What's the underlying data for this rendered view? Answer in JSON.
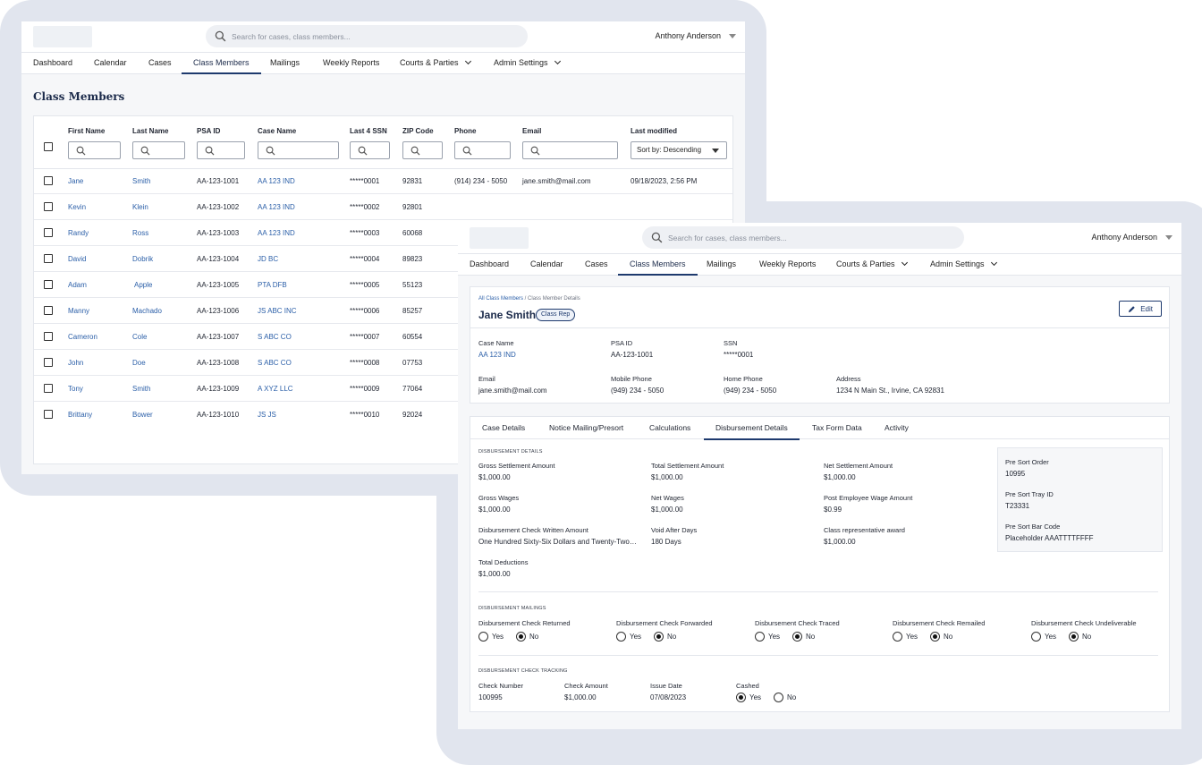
{
  "app": {
    "search_placeholder": "Search for cases, class members...",
    "user_name": "Anthony Anderson",
    "nav": [
      {
        "label": "Dashboard"
      },
      {
        "label": "Calendar"
      },
      {
        "label": "Cases"
      },
      {
        "label": "Class Members"
      },
      {
        "label": "Mailings"
      },
      {
        "label": "Weekly Reports"
      },
      {
        "label": "Courts & Parties"
      },
      {
        "label": "Admin Settings"
      }
    ],
    "active_nav": "Class Members"
  },
  "list_page": {
    "title": "Class Members",
    "columns": {
      "first_name": "First Name",
      "last_name": "Last Name",
      "psa_id": "PSA ID",
      "case_name": "Case Name",
      "last4": "Last 4 SSN",
      "zip": "ZIP Code",
      "phone": "Phone",
      "email": "Email",
      "last_modified": "Last modified"
    },
    "sort_label": "Sort by: Descending",
    "rows": [
      {
        "first": "Jane",
        "last": "Smith",
        "psa": "AA-123-1001",
        "case": "AA 123 IND",
        "ssn": "*****0001",
        "zip": "92831",
        "phone": "(914) 234 - 5050",
        "email": "jane.smith@mail.com",
        "modified": "09/18/2023, 2:56 PM"
      },
      {
        "first": "Kevin",
        "last": "Klein",
        "psa": "AA-123-1002",
        "case": "AA 123 IND",
        "ssn": "*****0002",
        "zip": "92801"
      },
      {
        "first": "Randy",
        "last": "Ross",
        "psa": "AA-123-1003",
        "case": "AA 123 IND",
        "ssn": "*****0003",
        "zip": "60068"
      },
      {
        "first": "David",
        "last": "Dobrik",
        "psa": "AA-123-1004",
        "case": "JD BC",
        "ssn": "*****0004",
        "zip": "89823"
      },
      {
        "first": "Adam",
        "last": "Apple",
        "psa": "AA-123-1005",
        "case": "PTA DFB",
        "ssn": "*****0005",
        "zip": "55123"
      },
      {
        "first": "Manny",
        "last": "Machado",
        "psa": "AA-123-1006",
        "case": "JS ABC INC",
        "ssn": "*****0006",
        "zip": "85257"
      },
      {
        "first": "Cameron",
        "last": "Cole",
        "psa": "AA-123-1007",
        "case": "S ABC CO",
        "ssn": "*****0007",
        "zip": "60554"
      },
      {
        "first": "John",
        "last": "Doe",
        "psa": "AA-123-1008",
        "case": "S ABC CO",
        "ssn": "*****0008",
        "zip": "07753"
      },
      {
        "first": "Tony",
        "last": "Smith",
        "psa": "AA-123-1009",
        "case": "A XYZ LLC",
        "ssn": "*****0009",
        "zip": "77064"
      },
      {
        "first": "Brittany",
        "last": "Bower",
        "psa": "AA-123-1010",
        "case": "JS JS",
        "ssn": "*****0010",
        "zip": "92024"
      }
    ]
  },
  "detail_page": {
    "breadcrumb_root": "All Class Members",
    "breadcrumb_sep": " / ",
    "breadcrumb_current": "Class Member Details",
    "name": "Jane Smith",
    "badge": "Class Rep",
    "edit_label": "Edit",
    "fields": {
      "case_name": {
        "label": "Case Name",
        "value": "AA 123 IND"
      },
      "psa_id": {
        "label": "PSA ID",
        "value": "AA-123-1001"
      },
      "ssn": {
        "label": "SSN",
        "value": "*****0001"
      },
      "email": {
        "label": "Email",
        "value": "jane.smith@mail.com"
      },
      "mobile": {
        "label": "Mobile Phone",
        "value": "(949) 234 - 5050"
      },
      "home": {
        "label": "Home Phone",
        "value": "(949) 234 - 5050"
      },
      "address": {
        "label": "Address",
        "value": "1234 N Main St., Irvine, CA 92831"
      }
    },
    "tabs": [
      {
        "label": "Case Details"
      },
      {
        "label": "Notice Mailing/Presort"
      },
      {
        "label": "Calculations"
      },
      {
        "label": "Disbursement Details"
      },
      {
        "label": "Tax Form Data"
      },
      {
        "label": "Activity"
      }
    ],
    "active_tab": "Disbursement Details",
    "disbursement": {
      "section_title": "DISBURSEMENT DETAILS",
      "items": [
        {
          "label": "Gross Settlement Amount",
          "value": "$1,000.00"
        },
        {
          "label": "Total Settlement Amount",
          "value": "$1,000.00"
        },
        {
          "label": "Net Settlement Amount",
          "value": "$1,000.00"
        },
        {
          "label": "Gross Wages",
          "value": "$1,000.00"
        },
        {
          "label": "Net Wages",
          "value": "$1,000.00"
        },
        {
          "label": "Post Employee Wage Amount",
          "value": "$0.99"
        },
        {
          "label": "Disbursement Check Written Amount",
          "value": "One Hundred Sixty-Six Dollars and Twenty-Two…"
        },
        {
          "label": "Void After Days",
          "value": "180 Days"
        },
        {
          "label": "Class representative award",
          "value": "$1,000.00"
        },
        {
          "label": "Total Deductions",
          "value": "$1,000.00"
        }
      ],
      "presort": [
        {
          "label": "Pre Sort Order",
          "value": "10995"
        },
        {
          "label": "Pre Sort Tray ID",
          "value": "T23331"
        },
        {
          "label": "Pre Sort Bar Code",
          "value": "Placeholder AAATTTTFFFF"
        }
      ]
    },
    "mailings": {
      "section_title": "DISBURSEMENT MAILINGS",
      "yes_label": "Yes",
      "no_label": "No",
      "items": [
        {
          "label": "Disbursement Check Returned",
          "selected": "No"
        },
        {
          "label": "Disbursement Check Forwarded",
          "selected": "No"
        },
        {
          "label": "Disbursement Check Traced",
          "selected": "No"
        },
        {
          "label": "Disbursement Check Remailed",
          "selected": "No"
        },
        {
          "label": "Disbursement Check Undeliverable",
          "selected": "No"
        }
      ]
    },
    "tracking": {
      "section_title": "DISBURSEMENT CHECK TRACKING",
      "items": [
        {
          "label": "Check Number",
          "value": "100995"
        },
        {
          "label": "Check Amount",
          "value": "$1,000.00"
        },
        {
          "label": "Issue Date",
          "value": "07/08/2023"
        }
      ],
      "cashed": {
        "label": "Cashed",
        "selected": "Yes"
      }
    }
  }
}
